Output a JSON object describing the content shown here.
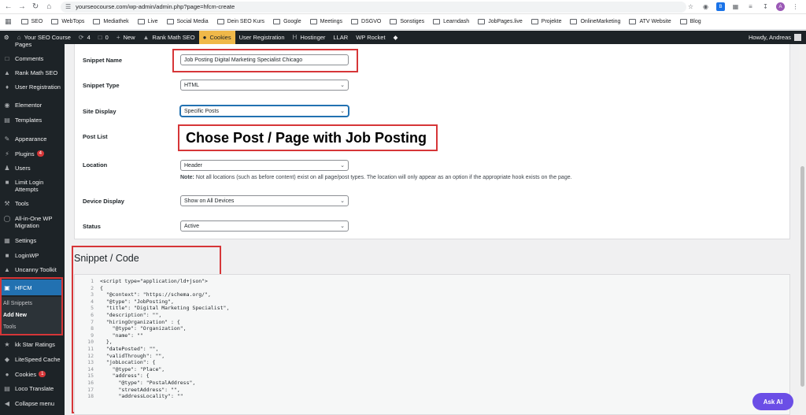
{
  "browser": {
    "url": "yourseocourse.com/wp-admin/admin.php?page=hfcm-create",
    "profile_initial": "A"
  },
  "bookmarks": [
    "SEO",
    "WebTops",
    "Mediathek",
    "Live",
    "Social Media",
    "Dein SEO Kurs",
    "Google",
    "Meetings",
    "DSGVO",
    "Sonstiges",
    "Learndash",
    "JobPages.live",
    "Projekte",
    "OnlineMarketing",
    "ATV Website",
    "Blog"
  ],
  "admin_bar": {
    "site_name": "Your SEO Course",
    "updates": "4",
    "comments": "0",
    "new_label": "New",
    "rank_math": "Rank Math SEO",
    "cookies": "Cookies",
    "user_registration": "User Registration",
    "hostinger": "Hostinger",
    "llar": "LLAR",
    "wp_rocket": "WP Rocket",
    "howdy": "Howdy, Andreas"
  },
  "sidebar": {
    "partial_top": "Pages",
    "comments": "Comments",
    "rank_math": "Rank Math SEO",
    "user_registration": "User Registration",
    "elementor": "Elementor",
    "templates": "Templates",
    "appearance": "Appearance",
    "plugins": "Plugins",
    "plugins_badge": "4",
    "users": "Users",
    "limit_login_1": "Limit Login",
    "limit_login_2": "Attempts",
    "tools": "Tools",
    "aio_migration_1": "All-in-One WP",
    "aio_migration_2": "Migration",
    "settings": "Settings",
    "loginwp": "LoginWP",
    "uncanny": "Uncanny Toolkit",
    "hfcm": "HFCM",
    "all_snippets": "All Snippets",
    "add_new": "Add New",
    "tools_sub": "Tools",
    "kk_star": "kk Star Ratings",
    "litespeed": "LiteSpeed Cache",
    "cookies": "Cookies",
    "cookies_badge": "1",
    "loco": "Loco Translate",
    "collapse": "Collapse menu"
  },
  "form": {
    "snippet_name_label": "Snippet Name",
    "snippet_name_value": "Job Posting Digital Marketing Specialist Chicago",
    "snippet_type_label": "Snippet Type",
    "snippet_type_value": "HTML",
    "site_display_label": "Site Display",
    "site_display_value": "Specific Posts",
    "post_list_label": "Post List",
    "callout_text": "Chose Post / Page with Job Posting",
    "location_label": "Location",
    "location_value": "Header",
    "note_prefix": "Note:",
    "note_text": " Not all locations (such as before content) exist on all page/post types. The location will only appear as an option if the appropriate hook exists on the page.",
    "device_label": "Device Display",
    "device_value": "Show on All Devices",
    "status_label": "Status",
    "status_value": "Active"
  },
  "code_section": {
    "title": "Snippet / Code",
    "lines": [
      "<script type=\"application/ld+json\">",
      "{",
      "  \"@context\": \"https://schema.org/\",",
      "  \"@type\": \"JobPosting\",",
      "  \"title\": \"Digital Marketing Specialist\",",
      "  \"description\": \"\",",
      "  \"hiringOrganization\" : {",
      "    \"@type\": \"Organization\",",
      "    \"name\": \"\"",
      "  },",
      "  \"datePosted\": \"\",",
      "  \"validThrough\": \"\",",
      "  \"jobLocation\": {",
      "    \"@type\": \"Place\",",
      "    \"address\": {",
      "      \"@type\": \"PostalAddress\",",
      "      \"streetAddress\": \"\",",
      "      \"addressLocality\": \"\""
    ]
  },
  "ask_ai": "Ask AI"
}
